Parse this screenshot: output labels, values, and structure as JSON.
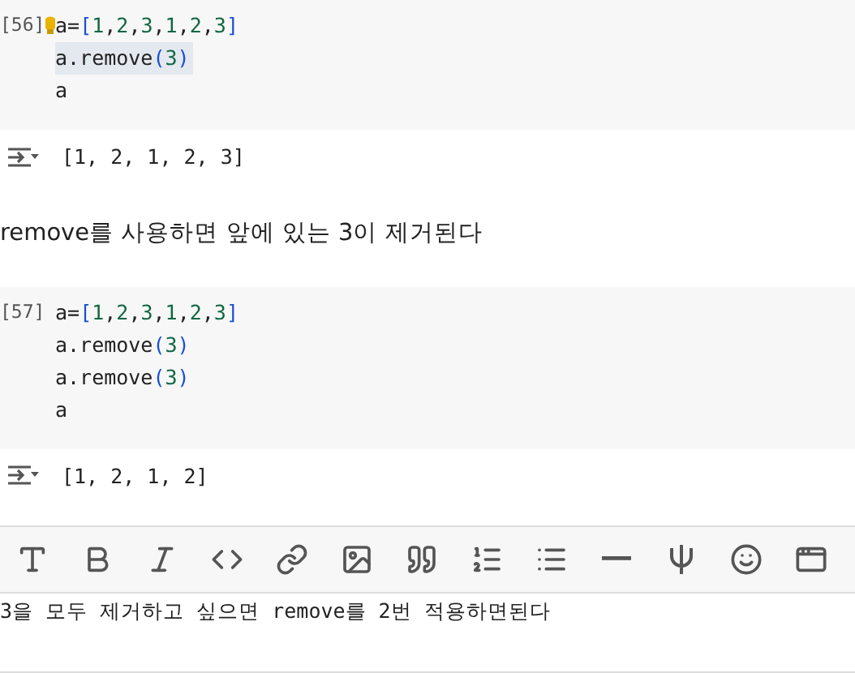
{
  "cells": [
    {
      "kind": "code",
      "execution_count": "[56]",
      "lines": [
        {
          "text": "a=[1,2,3,1,2,3]",
          "highlighted": false,
          "hint": true
        },
        {
          "text": "a.remove(3)",
          "highlighted": true,
          "hint": false
        },
        {
          "text": "a",
          "highlighted": false,
          "hint": false
        }
      ],
      "output": "[1, 2, 1, 2, 3]"
    },
    {
      "kind": "text",
      "text": "remove를 사용하면 앞에 있는 3이 제거된다"
    },
    {
      "kind": "code",
      "execution_count": "[57]",
      "lines": [
        {
          "text": "a=[1,2,3,1,2,3]",
          "highlighted": false,
          "hint": false
        },
        {
          "text": "a.remove(3)",
          "highlighted": false,
          "hint": false
        },
        {
          "text": "a.remove(3)",
          "highlighted": false,
          "hint": false
        },
        {
          "text": "a",
          "highlighted": false,
          "hint": false
        }
      ],
      "output": "[1, 2, 1, 2]"
    },
    {
      "kind": "editor",
      "toolbar": [
        {
          "kind": "text-size"
        },
        {
          "kind": "bold"
        },
        {
          "kind": "italic"
        },
        {
          "kind": "code"
        },
        {
          "kind": "link"
        },
        {
          "kind": "image"
        },
        {
          "kind": "quote"
        },
        {
          "kind": "numbered-list"
        },
        {
          "kind": "bullet-list"
        },
        {
          "kind": "rule"
        },
        {
          "kind": "psi"
        },
        {
          "kind": "emoji"
        },
        {
          "kind": "window"
        }
      ],
      "value": "3을 모두 제거하고 싶으면 remove를 2번 적용하면된다"
    }
  ]
}
